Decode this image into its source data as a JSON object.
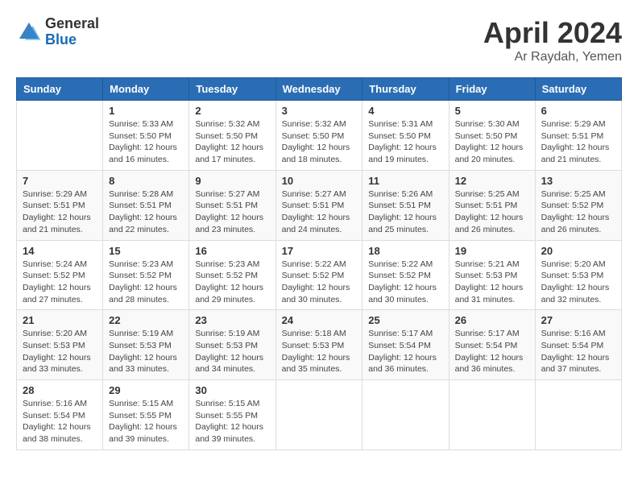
{
  "header": {
    "logo_general": "General",
    "logo_blue": "Blue",
    "month_title": "April 2024",
    "location": "Ar Raydah, Yemen"
  },
  "days_of_week": [
    "Sunday",
    "Monday",
    "Tuesday",
    "Wednesday",
    "Thursday",
    "Friday",
    "Saturday"
  ],
  "weeks": [
    [
      {
        "day": "",
        "sunrise": "",
        "sunset": "",
        "daylight": ""
      },
      {
        "day": "1",
        "sunrise": "Sunrise: 5:33 AM",
        "sunset": "Sunset: 5:50 PM",
        "daylight": "Daylight: 12 hours and 16 minutes."
      },
      {
        "day": "2",
        "sunrise": "Sunrise: 5:32 AM",
        "sunset": "Sunset: 5:50 PM",
        "daylight": "Daylight: 12 hours and 17 minutes."
      },
      {
        "day": "3",
        "sunrise": "Sunrise: 5:32 AM",
        "sunset": "Sunset: 5:50 PM",
        "daylight": "Daylight: 12 hours and 18 minutes."
      },
      {
        "day": "4",
        "sunrise": "Sunrise: 5:31 AM",
        "sunset": "Sunset: 5:50 PM",
        "daylight": "Daylight: 12 hours and 19 minutes."
      },
      {
        "day": "5",
        "sunrise": "Sunrise: 5:30 AM",
        "sunset": "Sunset: 5:50 PM",
        "daylight": "Daylight: 12 hours and 20 minutes."
      },
      {
        "day": "6",
        "sunrise": "Sunrise: 5:29 AM",
        "sunset": "Sunset: 5:51 PM",
        "daylight": "Daylight: 12 hours and 21 minutes."
      }
    ],
    [
      {
        "day": "7",
        "sunrise": "Sunrise: 5:29 AM",
        "sunset": "Sunset: 5:51 PM",
        "daylight": "Daylight: 12 hours and 21 minutes."
      },
      {
        "day": "8",
        "sunrise": "Sunrise: 5:28 AM",
        "sunset": "Sunset: 5:51 PM",
        "daylight": "Daylight: 12 hours and 22 minutes."
      },
      {
        "day": "9",
        "sunrise": "Sunrise: 5:27 AM",
        "sunset": "Sunset: 5:51 PM",
        "daylight": "Daylight: 12 hours and 23 minutes."
      },
      {
        "day": "10",
        "sunrise": "Sunrise: 5:27 AM",
        "sunset": "Sunset: 5:51 PM",
        "daylight": "Daylight: 12 hours and 24 minutes."
      },
      {
        "day": "11",
        "sunrise": "Sunrise: 5:26 AM",
        "sunset": "Sunset: 5:51 PM",
        "daylight": "Daylight: 12 hours and 25 minutes."
      },
      {
        "day": "12",
        "sunrise": "Sunrise: 5:25 AM",
        "sunset": "Sunset: 5:51 PM",
        "daylight": "Daylight: 12 hours and 26 minutes."
      },
      {
        "day": "13",
        "sunrise": "Sunrise: 5:25 AM",
        "sunset": "Sunset: 5:52 PM",
        "daylight": "Daylight: 12 hours and 26 minutes."
      }
    ],
    [
      {
        "day": "14",
        "sunrise": "Sunrise: 5:24 AM",
        "sunset": "Sunset: 5:52 PM",
        "daylight": "Daylight: 12 hours and 27 minutes."
      },
      {
        "day": "15",
        "sunrise": "Sunrise: 5:23 AM",
        "sunset": "Sunset: 5:52 PM",
        "daylight": "Daylight: 12 hours and 28 minutes."
      },
      {
        "day": "16",
        "sunrise": "Sunrise: 5:23 AM",
        "sunset": "Sunset: 5:52 PM",
        "daylight": "Daylight: 12 hours and 29 minutes."
      },
      {
        "day": "17",
        "sunrise": "Sunrise: 5:22 AM",
        "sunset": "Sunset: 5:52 PM",
        "daylight": "Daylight: 12 hours and 30 minutes."
      },
      {
        "day": "18",
        "sunrise": "Sunrise: 5:22 AM",
        "sunset": "Sunset: 5:52 PM",
        "daylight": "Daylight: 12 hours and 30 minutes."
      },
      {
        "day": "19",
        "sunrise": "Sunrise: 5:21 AM",
        "sunset": "Sunset: 5:53 PM",
        "daylight": "Daylight: 12 hours and 31 minutes."
      },
      {
        "day": "20",
        "sunrise": "Sunrise: 5:20 AM",
        "sunset": "Sunset: 5:53 PM",
        "daylight": "Daylight: 12 hours and 32 minutes."
      }
    ],
    [
      {
        "day": "21",
        "sunrise": "Sunrise: 5:20 AM",
        "sunset": "Sunset: 5:53 PM",
        "daylight": "Daylight: 12 hours and 33 minutes."
      },
      {
        "day": "22",
        "sunrise": "Sunrise: 5:19 AM",
        "sunset": "Sunset: 5:53 PM",
        "daylight": "Daylight: 12 hours and 33 minutes."
      },
      {
        "day": "23",
        "sunrise": "Sunrise: 5:19 AM",
        "sunset": "Sunset: 5:53 PM",
        "daylight": "Daylight: 12 hours and 34 minutes."
      },
      {
        "day": "24",
        "sunrise": "Sunrise: 5:18 AM",
        "sunset": "Sunset: 5:53 PM",
        "daylight": "Daylight: 12 hours and 35 minutes."
      },
      {
        "day": "25",
        "sunrise": "Sunrise: 5:17 AM",
        "sunset": "Sunset: 5:54 PM",
        "daylight": "Daylight: 12 hours and 36 minutes."
      },
      {
        "day": "26",
        "sunrise": "Sunrise: 5:17 AM",
        "sunset": "Sunset: 5:54 PM",
        "daylight": "Daylight: 12 hours and 36 minutes."
      },
      {
        "day": "27",
        "sunrise": "Sunrise: 5:16 AM",
        "sunset": "Sunset: 5:54 PM",
        "daylight": "Daylight: 12 hours and 37 minutes."
      }
    ],
    [
      {
        "day": "28",
        "sunrise": "Sunrise: 5:16 AM",
        "sunset": "Sunset: 5:54 PM",
        "daylight": "Daylight: 12 hours and 38 minutes."
      },
      {
        "day": "29",
        "sunrise": "Sunrise: 5:15 AM",
        "sunset": "Sunset: 5:55 PM",
        "daylight": "Daylight: 12 hours and 39 minutes."
      },
      {
        "day": "30",
        "sunrise": "Sunrise: 5:15 AM",
        "sunset": "Sunset: 5:55 PM",
        "daylight": "Daylight: 12 hours and 39 minutes."
      },
      {
        "day": "",
        "sunrise": "",
        "sunset": "",
        "daylight": ""
      },
      {
        "day": "",
        "sunrise": "",
        "sunset": "",
        "daylight": ""
      },
      {
        "day": "",
        "sunrise": "",
        "sunset": "",
        "daylight": ""
      },
      {
        "day": "",
        "sunrise": "",
        "sunset": "",
        "daylight": ""
      }
    ]
  ]
}
